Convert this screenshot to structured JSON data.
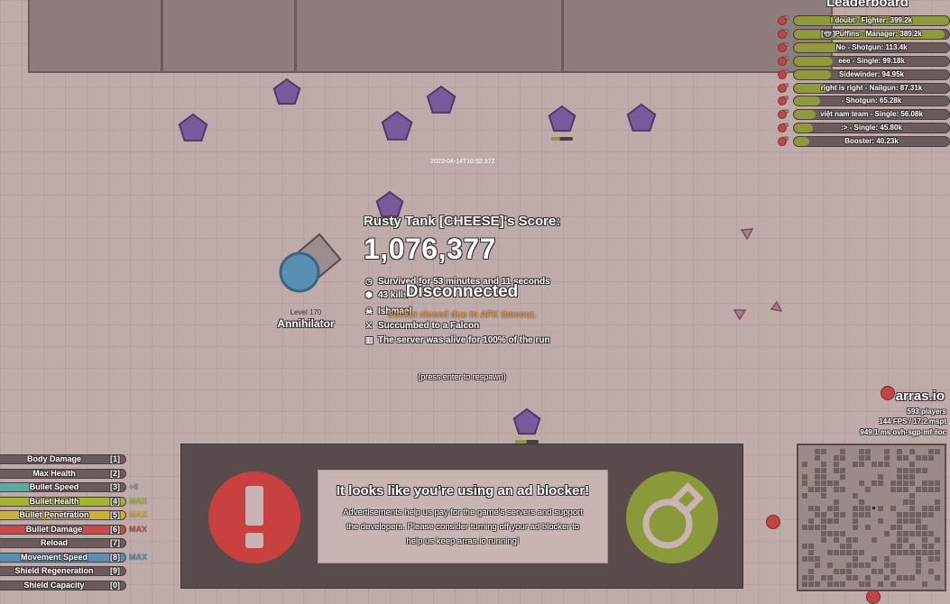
{
  "leaderboard": {
    "title": "Leaderboard",
    "entries": [
      {
        "label": "I doubt - Fighter: 399.2k",
        "fill": 1.0
      },
      {
        "label": "[🐨]Puffins - Manager: 389.2k",
        "fill": 0.97
      },
      {
        "label": "No - Shotgun: 113.4k",
        "fill": 0.29
      },
      {
        "label": "eee - Single: 99.18k",
        "fill": 0.25
      },
      {
        "label": "Sidewinder: 94.95k",
        "fill": 0.24
      },
      {
        "label": "right is right - Nailgun: 87.31k",
        "fill": 0.22
      },
      {
        "label": "- Shotgun: 65.28k",
        "fill": 0.17
      },
      {
        "label": "việt nam team - Single: 56.08k",
        "fill": 0.14
      },
      {
        "label": ":> - Single: 45.80k",
        "fill": 0.12
      },
      {
        "label": "Booster: 40.23k",
        "fill": 0.1
      }
    ]
  },
  "timestamp": "2023-04-14T10:52:37Z",
  "player": {
    "level": "Level 170",
    "tank": "Annihilator"
  },
  "death": {
    "score_title": "Rusty Tank [CHEESE]'s Score:",
    "score": "1,076,377",
    "lines": [
      {
        "icon": "clock-icon",
        "text": "Survived for 53 minutes and 11 seconds"
      },
      {
        "icon": "kills-icon",
        "text": "43 kills"
      },
      {
        "icon": "skull-icon",
        "text": "Ishmael"
      },
      {
        "icon": "sword-icon",
        "text": "Succumbed to a Falcon"
      },
      {
        "icon": "server-icon",
        "text": "The server was alive for 100% of the run"
      }
    ],
    "disconnected": "Disconnected",
    "reason": "Socket closed due to AFK timeout.",
    "respawn": "(press enter to respawn)"
  },
  "server": {
    "name": "arras.io",
    "players": "593 players",
    "fps": "144 FPS / 17.2 mspt",
    "ping": "949.1 ms  ovh-sgp-mf #oc"
  },
  "stats": [
    {
      "label": "Body Damage",
      "key": "[1]",
      "extra": "",
      "color": "#a98f8f",
      "fill": 0
    },
    {
      "label": "Max Health",
      "key": "[2]",
      "extra": "",
      "color": "#a98f8f",
      "fill": 0
    },
    {
      "label": "Bullet Speed",
      "key": "[3]",
      "extra": "+6",
      "color": "#5fa7a0",
      "fill": 0.3
    },
    {
      "label": "Bullet Health",
      "key": "[4]",
      "extra": "MAX",
      "color": "#a4b23a",
      "fill": 1.0
    },
    {
      "label": "Bullet Penetration",
      "key": "[5]",
      "extra": "MAX",
      "color": "#c9b13a",
      "fill": 1.0
    },
    {
      "label": "Bullet Damage",
      "key": "[6]",
      "extra": "MAX",
      "color": "#c94a4a",
      "fill": 1.0
    },
    {
      "label": "Reload",
      "key": "[7]",
      "extra": "",
      "color": "#a98f8f",
      "fill": 0
    },
    {
      "label": "Movement Speed",
      "key": "[8]",
      "extra": "MAX",
      "color": "#5a8fb3",
      "fill": 1.0
    },
    {
      "label": "Shield Regeneration",
      "key": "[9]",
      "extra": "",
      "color": "#a98f8f",
      "fill": 0
    },
    {
      "label": "Shield Capacity",
      "key": "[0]",
      "extra": "",
      "color": "#a98f8f",
      "fill": 0
    }
  ],
  "ad": {
    "title": "It looks like you're using an ad blocker!",
    "body": "Advertisements help us pay for the game's servers and support the developers. Please consider turning off your ad blocker to help us keep arras.io running!"
  },
  "colors": {
    "background": "#bfacaa",
    "pentagon": "#7a5a9c",
    "player": "#5a8fb3",
    "ad_red": "#c94040",
    "ad_green": "#8a9a3a"
  }
}
